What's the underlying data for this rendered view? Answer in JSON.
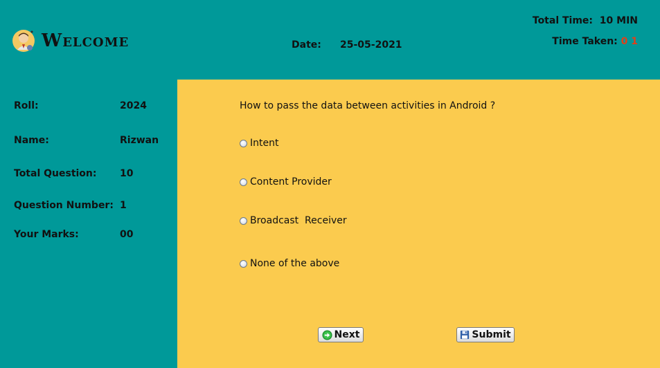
{
  "header": {
    "welcome": "Welcome",
    "date_label": "Date:",
    "date_value": "25-05-2021",
    "total_time_label": "Total Time:",
    "total_time_value": "10 MIN",
    "time_taken_label": "Time Taken:",
    "time_taken_value": "0 1"
  },
  "student": {
    "rows": [
      {
        "label": "Roll:",
        "value": "2024"
      },
      {
        "label": "Name:",
        "value": "Rizwan"
      },
      {
        "label": "Total Question:",
        "value": "10"
      },
      {
        "label": "Question Number:",
        "value": "1"
      },
      {
        "label": "Your Marks:",
        "value": "00"
      }
    ]
  },
  "quiz": {
    "question": "How to pass the data between activities in Android ?",
    "options": [
      "Intent",
      "Content Provider",
      "Broadcast  Receiver",
      "None of the above"
    ],
    "next_label": "Next",
    "submit_label": "Submit"
  },
  "colors": {
    "background": "#009999",
    "quiz_panel": "#fbcb4e",
    "timer_accent": "#e0401a"
  },
  "icons": {
    "avatar": "student-avatar-icon",
    "next": "green-arrow-icon",
    "submit": "floppy-disk-icon"
  }
}
